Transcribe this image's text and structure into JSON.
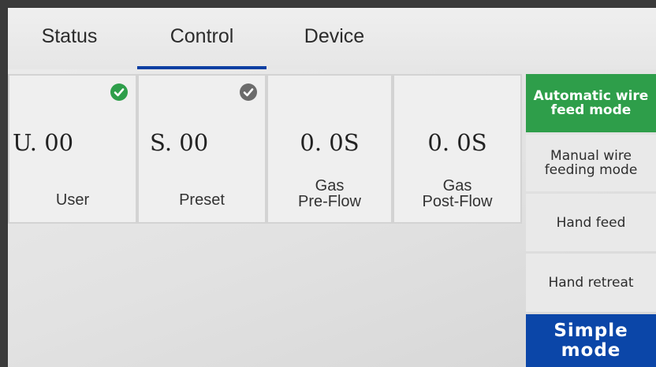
{
  "tabs": [
    {
      "label": "Status",
      "active": false
    },
    {
      "label": "Control",
      "active": true
    },
    {
      "label": "Device",
      "active": false
    }
  ],
  "cards": [
    {
      "value": "U. 00",
      "label": "User",
      "check": "check-icon-green"
    },
    {
      "value": "S. 00",
      "label": "Preset",
      "check": "check-icon-gray"
    },
    {
      "value": "0. 0S",
      "label_line1": "Gas",
      "label_line2": "Pre-Flow"
    },
    {
      "value": "0. 0S",
      "label_line1": "Gas",
      "label_line2": "Post-Flow"
    }
  ],
  "side_buttons": [
    {
      "label_line1": "Automatic wire",
      "label_line2": "feed mode",
      "style": "green"
    },
    {
      "label_line1": "Manual wire",
      "label_line2": "feeding mode",
      "style": "gray"
    },
    {
      "label": "Hand feed",
      "style": "gray"
    },
    {
      "label": "Hand retreat",
      "style": "gray"
    },
    {
      "label_line1": "Simple",
      "label_line2": "mode",
      "style": "blue"
    }
  ],
  "colors": {
    "accent_blue": "#0b46a8",
    "active_green": "#2e9e4a",
    "check_green": "#2e9e4a",
    "check_gray": "#6b6b6b"
  }
}
